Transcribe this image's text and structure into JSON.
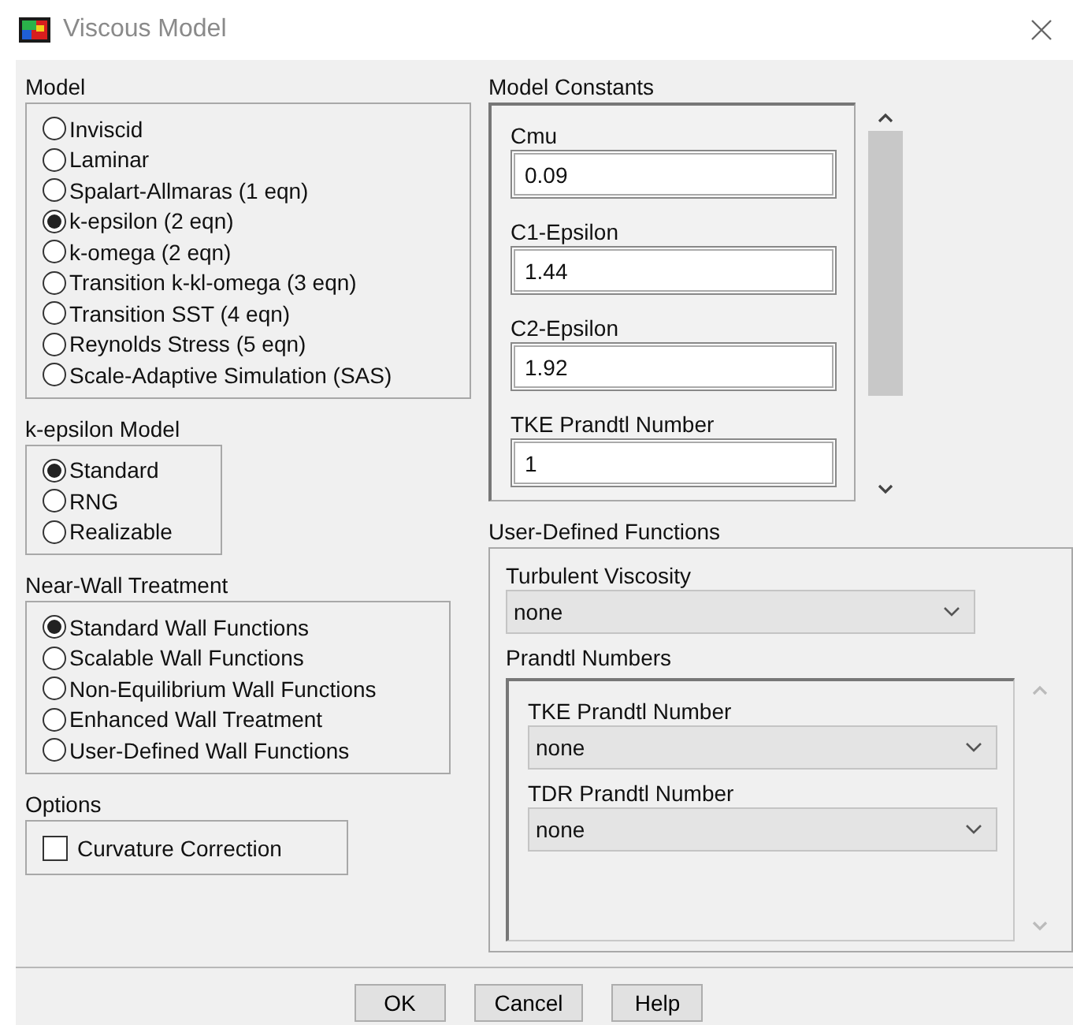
{
  "window": {
    "title": "Viscous Model"
  },
  "model": {
    "label": "Model",
    "options": [
      {
        "label": "Inviscid",
        "selected": false
      },
      {
        "label": "Laminar",
        "selected": false
      },
      {
        "label": "Spalart-Allmaras (1 eqn)",
        "selected": false
      },
      {
        "label": "k-epsilon (2 eqn)",
        "selected": true
      },
      {
        "label": "k-omega (2 eqn)",
        "selected": false
      },
      {
        "label": "Transition k-kl-omega (3 eqn)",
        "selected": false
      },
      {
        "label": "Transition SST (4 eqn)",
        "selected": false
      },
      {
        "label": "Reynolds Stress (5 eqn)",
        "selected": false
      },
      {
        "label": "Scale-Adaptive Simulation (SAS)",
        "selected": false
      }
    ]
  },
  "k_epsilon_model": {
    "label": "k-epsilon Model",
    "options": [
      {
        "label": "Standard",
        "selected": true
      },
      {
        "label": "RNG",
        "selected": false
      },
      {
        "label": "Realizable",
        "selected": false
      }
    ]
  },
  "near_wall_treatment": {
    "label": "Near-Wall Treatment",
    "options": [
      {
        "label": "Standard Wall Functions",
        "selected": true
      },
      {
        "label": "Scalable Wall Functions",
        "selected": false
      },
      {
        "label": "Non-Equilibrium Wall Functions",
        "selected": false
      },
      {
        "label": "Enhanced Wall Treatment",
        "selected": false
      },
      {
        "label": "User-Defined Wall Functions",
        "selected": false
      }
    ]
  },
  "options": {
    "label": "Options",
    "items": [
      {
        "label": "Curvature Correction",
        "checked": false
      }
    ]
  },
  "model_constants": {
    "label": "Model Constants",
    "fields": [
      {
        "label": "Cmu",
        "value": "0.09"
      },
      {
        "label": "C1-Epsilon",
        "value": "1.44"
      },
      {
        "label": "C2-Epsilon",
        "value": "1.92"
      },
      {
        "label": "TKE Prandtl Number",
        "value": "1"
      }
    ]
  },
  "user_defined_functions": {
    "label": "User-Defined Functions",
    "turbulent_viscosity": {
      "label": "Turbulent Viscosity",
      "value": "none"
    },
    "prandtl_numbers": {
      "label": "Prandtl Numbers",
      "fields": [
        {
          "label": "TKE Prandtl Number",
          "value": "none"
        },
        {
          "label": "TDR Prandtl Number",
          "value": "none"
        }
      ]
    }
  },
  "buttons": [
    "OK",
    "Cancel",
    "Help"
  ]
}
